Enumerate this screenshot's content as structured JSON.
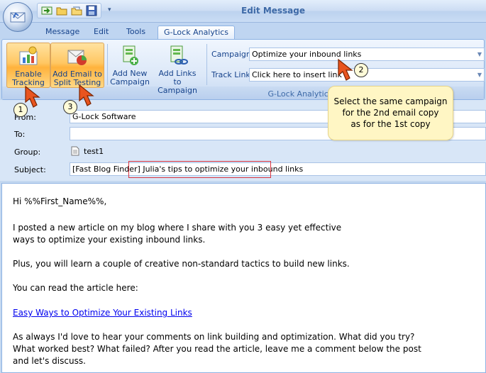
{
  "window": {
    "title": "Edit Message"
  },
  "tabs": [
    {
      "label": "Message"
    },
    {
      "label": "Edit"
    },
    {
      "label": "Tools"
    },
    {
      "label": "G-Lock Analytics"
    }
  ],
  "ribbon": {
    "buttons": [
      {
        "line1": "Enable",
        "line2": "Tracking"
      },
      {
        "line1": "Add Email to",
        "line2": "Split Testing"
      },
      {
        "line1": "Add New",
        "line2": "Campaign"
      },
      {
        "line1": "Add Links to",
        "line2": "Campaign"
      }
    ],
    "campaign_label": "Campaign",
    "campaign_value": "Optimize your inbound links",
    "track_link_label": "Track Link",
    "track_link_value": "Click here to insert link",
    "group_label": "G-Lock Analytics"
  },
  "header": {
    "from_label": "From:",
    "from_value": "G-Lock Software",
    "to_label": "To:",
    "to_value": "",
    "group_label": "Group:",
    "group_value": "test1",
    "subject_label": "Subject:",
    "subject_prefix": "[Fast Blog Finder]",
    "subject_text": "Julia's tips to optimize your inbound links"
  },
  "body": {
    "greeting": "Hi %%First_Name%%,",
    "p1_line1": "I posted a new article on my blog where I share with you 3 easy yet effective",
    "p1_line2": "ways to optimize your existing inbound links.",
    "p2": "Plus, you will learn a couple of creative non-standard tactics to build new links.",
    "p3": "You can read the article here:",
    "link": "Easy Ways to Optimize Your Existing Links",
    "p4_line1": "As always I'd love to hear your comments on link building and optimization. What did you try?",
    "p4_line2": "What worked best? What failed? After you read the article, leave me a comment below the post",
    "p4_line3": "and let's discuss."
  },
  "callouts": {
    "n1": "1",
    "n2": "2",
    "n3": "3",
    "tip_line1": "Select the same campaign",
    "tip_line2": "for the 2nd email copy",
    "tip_line3": "as for the 1st copy"
  },
  "icons": {
    "orb": "mail-orb-icon",
    "qat": [
      "send-icon",
      "open-folder-icon",
      "open-file-icon",
      "save-icon"
    ],
    "dropdown": "chevron-down-icon"
  }
}
